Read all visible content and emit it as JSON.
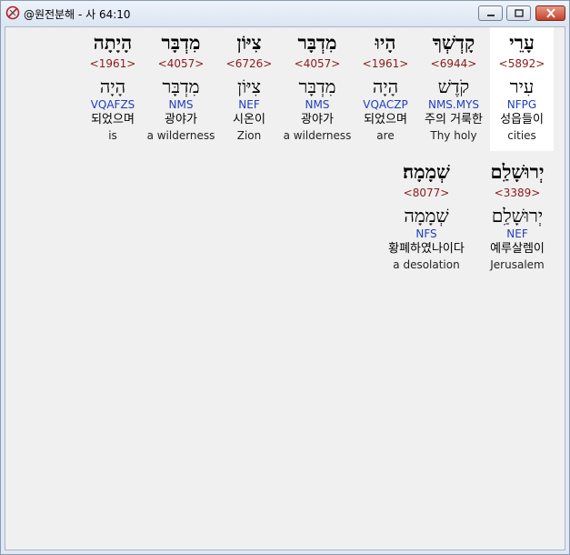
{
  "window": {
    "title": "@원전분해 - 사 64:10",
    "buttons": {
      "minimize": "minimize",
      "maximize": "maximize",
      "close": "close"
    }
  },
  "rows": [
    {
      "words": [
        {
          "hebrew": "עָרֵי",
          "strong": "<5892>",
          "lemma": "עִיר",
          "morph": "NFPG",
          "korean": "성읍들이",
          "english": "cities",
          "selected": true
        },
        {
          "hebrew": "קָדְשְׁךָ",
          "strong": "<6944>",
          "lemma": "קֹדֶשׁ",
          "morph": "NMS.MYS",
          "korean": "주의 거룩한",
          "english": "Thy holy"
        },
        {
          "hebrew": "הָיוּ",
          "strong": "<1961>",
          "lemma": "הָיָה",
          "morph": "VQACZP",
          "korean": "되었으며",
          "english": "are"
        },
        {
          "hebrew": "מִדְבָּר",
          "strong": "<4057>",
          "lemma": "מִדְבָּר",
          "morph": "NMS",
          "korean": "광야가",
          "english": "a wilderness"
        },
        {
          "hebrew": "צִיּוֹן",
          "strong": "<6726>",
          "lemma": "צִיּוֹן",
          "morph": "NEF",
          "korean": "시온이",
          "english": "Zion"
        },
        {
          "hebrew": "מִדְבָּר",
          "strong": "<4057>",
          "lemma": "מִדְבָּר",
          "morph": "NMS",
          "korean": "광야가",
          "english": "a wilderness"
        },
        {
          "hebrew": "הָיָתָה",
          "strong": "<1961>",
          "lemma": "הָיָה",
          "morph": "VQAFZS",
          "korean": "되었으며",
          "english": "is"
        }
      ]
    },
    {
      "words": [
        {
          "hebrew": "יְרוּשָׁלִַם",
          "strong": "<3389>",
          "lemma": "יְרוּשָׁלִַם",
          "morph": "NEF",
          "korean": "예루살렘이",
          "english": "Jerusalem"
        },
        {
          "hebrew": "שְׁמָמָה׃",
          "strong": "<8077>",
          "lemma": "שְׁמָמָה",
          "morph": "NFS",
          "korean": "황폐하였나이다",
          "english": "a desolation"
        }
      ]
    }
  ]
}
